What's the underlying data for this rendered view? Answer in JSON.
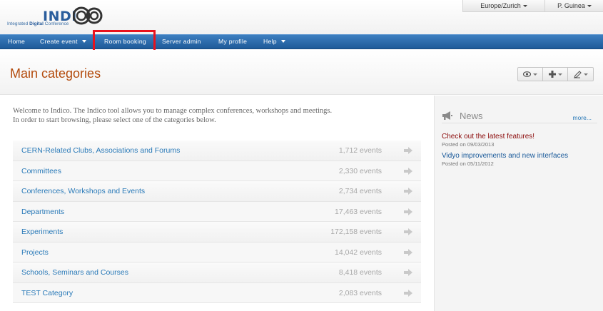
{
  "header": {
    "logo_word": "INDI",
    "logo_tag_prefix": "Integrated",
    "logo_tag_bold": "Digital",
    "logo_tag_suffix": "Conference",
    "timezone": "Europe/Zurich",
    "user": "P. Guinea"
  },
  "nav": {
    "items": [
      {
        "label": "Home"
      },
      {
        "label": "Create event"
      },
      {
        "label": "Room booking"
      },
      {
        "label": "Server admin"
      },
      {
        "label": "My profile"
      },
      {
        "label": "Help"
      }
    ]
  },
  "page": {
    "title": "Main categories",
    "welcome_line1": "Welcome to Indico. The Indico tool allows you to manage complex conferences, workshops and meetings.",
    "welcome_line2": "In order to start browsing, please select one of the categories below."
  },
  "categories": [
    {
      "name": "CERN-Related Clubs, Associations and Forums",
      "count": "1,712 events"
    },
    {
      "name": "Committees",
      "count": "2,330 events"
    },
    {
      "name": "Conferences, Workshops and Events",
      "count": "2,734 events"
    },
    {
      "name": "Departments",
      "count": "17,463 events"
    },
    {
      "name": "Experiments",
      "count": "172,158 events"
    },
    {
      "name": "Projects",
      "count": "14,042 events"
    },
    {
      "name": "Schools, Seminars and Courses",
      "count": "8,418 events"
    },
    {
      "name": "TEST Category",
      "count": "2,083 events"
    }
  ],
  "news": {
    "title": "News",
    "more": "more...",
    "items": [
      {
        "text": "Check out the latest features!",
        "date": "Posted on 09/03/2013",
        "color": "#8b0a0a"
      },
      {
        "text": "Vidyo improvements and new interfaces",
        "date": "Posted on 05/11/2012",
        "color": "#1a5a9a"
      }
    ]
  },
  "colors": {
    "nav_bg": "#2b6aa8",
    "title": "#b34a0c",
    "link": "#2a7ab8",
    "highlight": "#e8121e"
  }
}
